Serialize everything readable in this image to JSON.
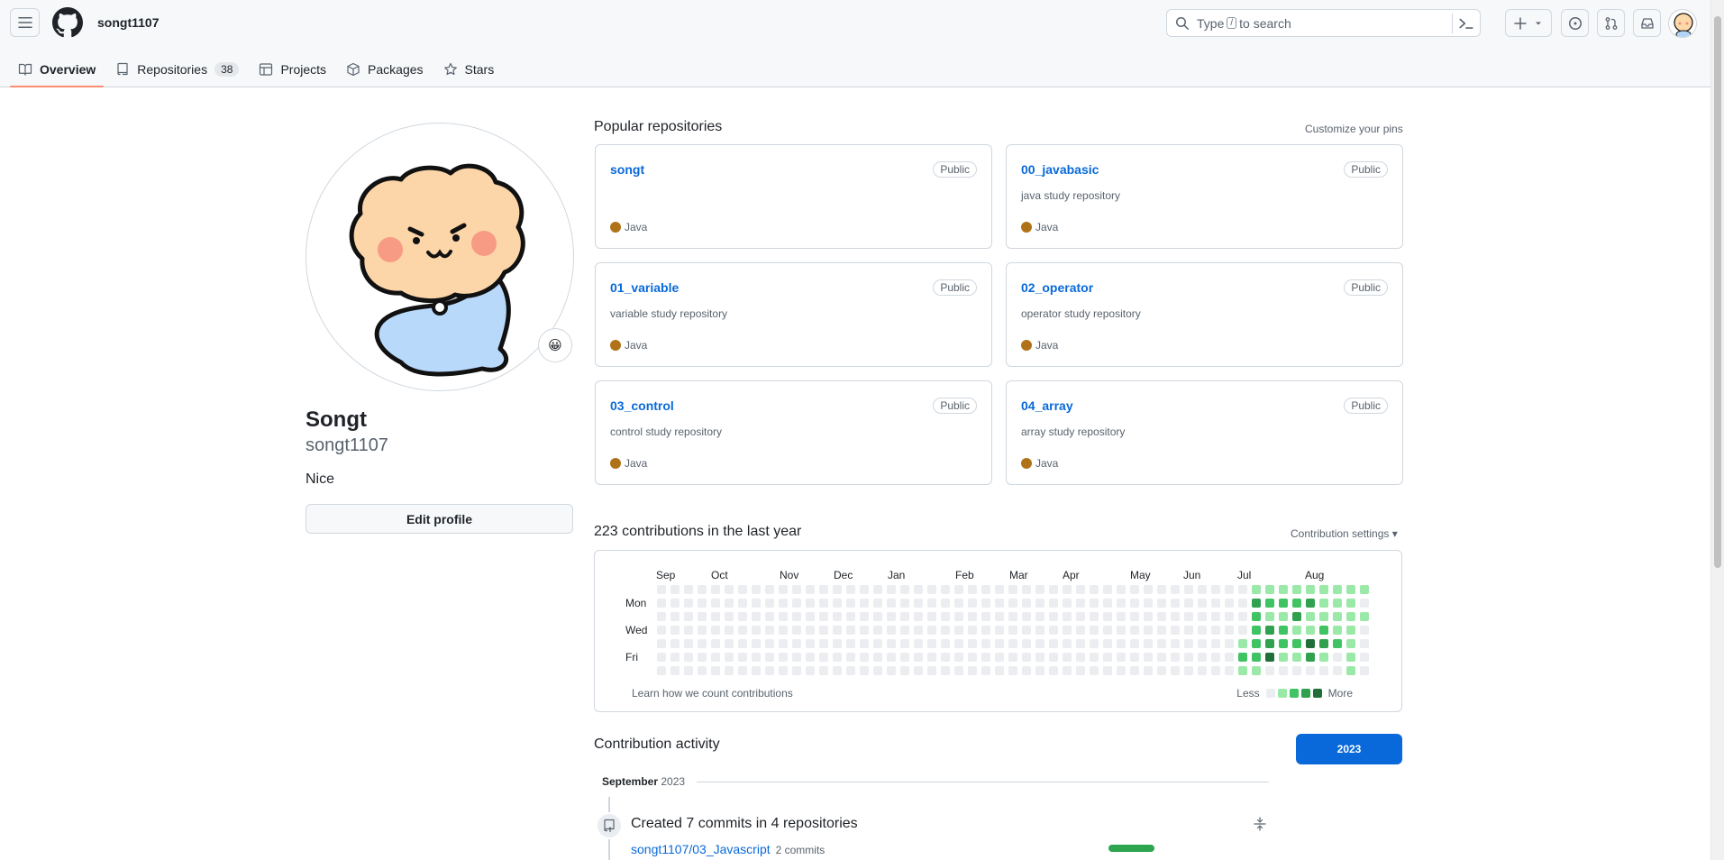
{
  "header": {
    "username": "songt1107",
    "search_placeholder_pre": "Type",
    "search_key": "/",
    "search_placeholder_post": "to search",
    "tabs": [
      {
        "label": "Overview",
        "icon": "book-icon"
      },
      {
        "label": "Repositories",
        "icon": "repo-icon",
        "count": "38"
      },
      {
        "label": "Projects",
        "icon": "table-icon"
      },
      {
        "label": "Packages",
        "icon": "package-icon"
      },
      {
        "label": "Stars",
        "icon": "star-icon"
      }
    ]
  },
  "profile": {
    "fullname": "Songt",
    "login": "songt1107",
    "bio": "Nice",
    "edit_label": "Edit profile",
    "status_emoji": "😀"
  },
  "popular": {
    "title": "Popular repositories",
    "customize": "Customize your pins",
    "repos": [
      {
        "name": "songt",
        "visibility": "Public",
        "desc": "",
        "lang": "Java"
      },
      {
        "name": "00_javabasic",
        "visibility": "Public",
        "desc": "java study repository",
        "lang": "Java"
      },
      {
        "name": "01_variable",
        "visibility": "Public",
        "desc": "variable study repository",
        "lang": "Java"
      },
      {
        "name": "02_operator",
        "visibility": "Public",
        "desc": "operator study repository",
        "lang": "Java"
      },
      {
        "name": "03_control",
        "visibility": "Public",
        "desc": "control study repository",
        "lang": "Java"
      },
      {
        "name": "04_array",
        "visibility": "Public",
        "desc": "array study repository",
        "lang": "Java"
      }
    ],
    "lang_color": "#b07219"
  },
  "contributions": {
    "title": "223 contributions in the last year",
    "settings": "Contribution settings ▾",
    "months": [
      "Sep",
      "Oct",
      "Nov",
      "Dec",
      "Jan",
      "Feb",
      "Mar",
      "Apr",
      "May",
      "Jun",
      "Jul",
      "Aug"
    ],
    "days": [
      "Mon",
      "Wed",
      "Fri"
    ],
    "learn": "Learn how we count contributions",
    "less": "Less",
    "more": "More",
    "colors": [
      "#ebedf0",
      "#9be9a8",
      "#40c463",
      "#30a14e",
      "#216e39"
    ],
    "active_weeks": [
      [
        0,
        0,
        0,
        0,
        1,
        2,
        1
      ],
      [
        1,
        3,
        2,
        2,
        2,
        2,
        1
      ],
      [
        1,
        2,
        1,
        3,
        3,
        4,
        0
      ],
      [
        1,
        2,
        1,
        2,
        2,
        1,
        0
      ],
      [
        1,
        2,
        3,
        1,
        2,
        1,
        0
      ],
      [
        1,
        3,
        1,
        1,
        4,
        3,
        0
      ],
      [
        1,
        1,
        1,
        2,
        3,
        1,
        0
      ],
      [
        1,
        1,
        1,
        1,
        2,
        0,
        0
      ],
      [
        1,
        1,
        1,
        1,
        1,
        1,
        1
      ],
      [
        1,
        0,
        1,
        0,
        0,
        0,
        0
      ]
    ]
  },
  "activity": {
    "title": "Contribution activity",
    "year": "2023",
    "period_month": "September",
    "period_year": "2023",
    "commits_title": "Created 7 commits in 4 repositories",
    "repo": "songt1107/03_Javascript",
    "repo_commits": "2 commits"
  }
}
